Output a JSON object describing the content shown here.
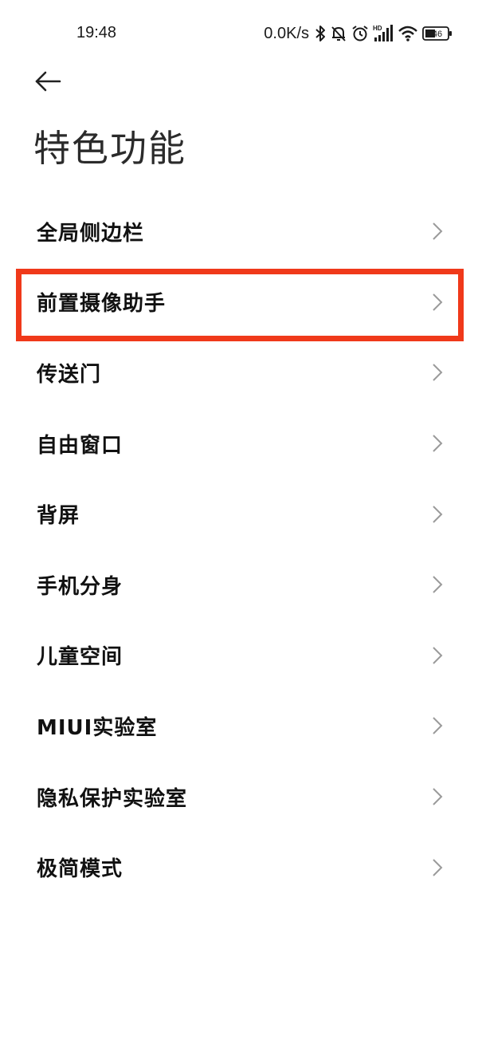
{
  "status_bar": {
    "time": "19:48",
    "net_speed": "0.0K/s",
    "network_badge": "HD",
    "battery_level": "46",
    "icons": [
      "bluetooth-icon",
      "mute-bell-icon",
      "alarm-icon",
      "signal-icon",
      "wifi-icon",
      "battery-icon"
    ]
  },
  "header": {
    "back_icon": "arrow-left-icon",
    "title": "特色功能"
  },
  "menu": {
    "items": [
      {
        "label": "全局侧边栏"
      },
      {
        "label": "前置摄像助手"
      },
      {
        "label": "传送门"
      },
      {
        "label": "自由窗口"
      },
      {
        "label": "背屏"
      },
      {
        "label": "手机分身"
      },
      {
        "label": "儿童空间"
      },
      {
        "label": "MIUI实验室"
      },
      {
        "label": "隐私保护实验室"
      },
      {
        "label": "极简模式"
      }
    ],
    "chevron_icon": "chevron-right-icon"
  },
  "highlight": {
    "target": "前置摄像助手",
    "color": "#f0391a"
  }
}
